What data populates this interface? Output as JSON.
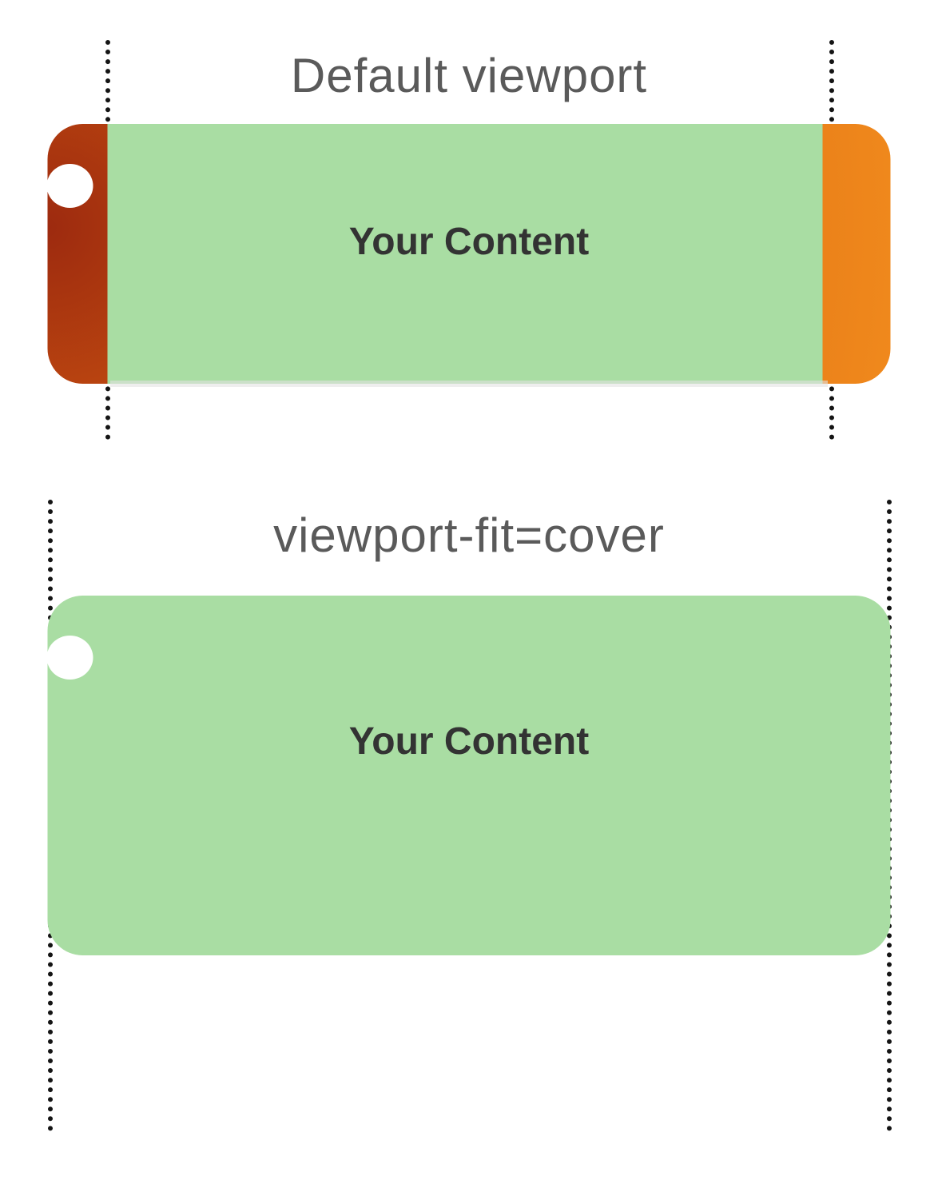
{
  "sections": {
    "default": {
      "title": "Default viewport",
      "content_label": "Your Content"
    },
    "cover": {
      "title": "viewport-fit=cover",
      "content_label": "Your Content"
    }
  },
  "colors": {
    "content_bg": "#a9dda3",
    "pillarbox_gradient_from": "#9d2a0f",
    "pillarbox_gradient_to": "#f0891c",
    "guide": "#141414",
    "text": "#333333",
    "title": "#5a5a5a"
  }
}
